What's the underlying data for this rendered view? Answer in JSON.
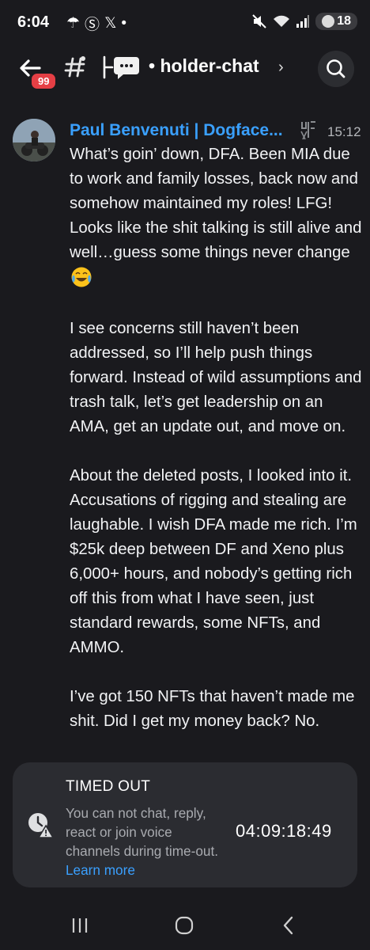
{
  "status_bar": {
    "time": "6:04",
    "icons": [
      "weather-icon",
      "s-app-icon",
      "x-app-icon",
      "dot-icon"
    ],
    "icon_glyphs": [
      "☂",
      "Ⓢ",
      "𝕏",
      "•"
    ],
    "battery": "18"
  },
  "header": {
    "notification_badge": "99",
    "channel_name": "holder-chat",
    "chevron": "›"
  },
  "message": {
    "author": "Paul Benvenuti | Dogface...",
    "timestamp": "15:12",
    "author_color": "#3aa0ff",
    "paragraph_1": "What’s goin’ down, DFA. Been MIA due to work and family losses, back now and somehow maintained my roles! LFG!  Looks like the shit talking is still alive and well…guess some things never change",
    "paragraph_2": "I see concerns still haven’t been addressed, so I’ll help push things forward. Instead of wild assumptions and trash talk, let’s get leadership on an AMA, get an update out, and move on.",
    "paragraph_3": "About the deleted posts, I looked into it. Accusations of rigging and stealing are laughable. I wish DFA made me rich. I’m $25k deep between DF and Xeno plus 6,000+ hours, and nobody’s getting rich off this from what I have seen, just standard rewards, some NFTs, and AMMO.",
    "paragraph_4": "I’ve got 150 NFTs that haven’t made me shit. Did I get my money back? No."
  },
  "timeout": {
    "title": "TIMED OUT",
    "description": "You can not chat, reply, react or join voice channels during time-out.",
    "link": "Learn more",
    "timer": "04:09:18:49",
    "link_color": "#3aa0ff"
  },
  "nav": {
    "recents": "|||",
    "home": "○",
    "back": "‹"
  }
}
